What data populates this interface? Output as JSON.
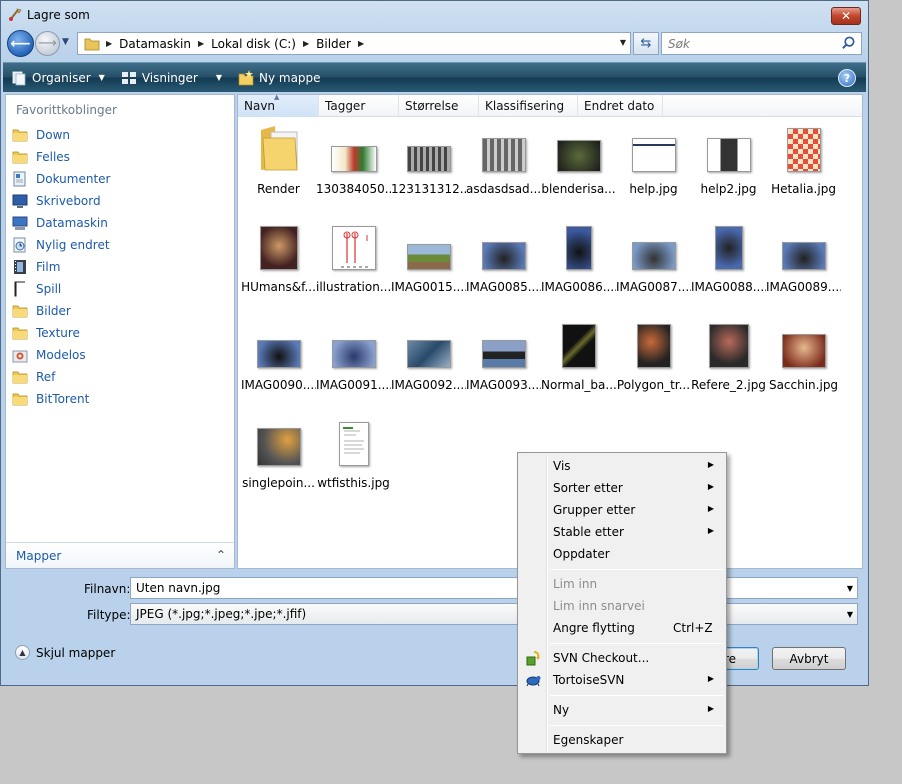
{
  "window": {
    "title": "Lagre som",
    "close_label": "✕"
  },
  "nav": {
    "breadcrumbs": [
      "Datamaskin",
      "Lokal disk (C:)",
      "Bilder"
    ],
    "search_placeholder": "Søk"
  },
  "toolbar": {
    "organize": "Organiser",
    "views": "Visninger",
    "new_folder": "Ny mappe",
    "help": "?"
  },
  "sidebar": {
    "title": "Favorittkoblinger",
    "items": [
      {
        "label": "Down",
        "icon": "folder-icon"
      },
      {
        "label": "Felles",
        "icon": "folder-icon"
      },
      {
        "label": "Dokumenter",
        "icon": "documents-icon"
      },
      {
        "label": "Skrivebord",
        "icon": "desktop-icon"
      },
      {
        "label": "Datamaskin",
        "icon": "computer-icon"
      },
      {
        "label": "Nylig endret",
        "icon": "recent-icon"
      },
      {
        "label": "Film",
        "icon": "film-icon"
      },
      {
        "label": "Spill",
        "icon": "blank-icon"
      },
      {
        "label": "Bilder",
        "icon": "folder-icon"
      },
      {
        "label": "Texture",
        "icon": "folder-icon"
      },
      {
        "label": "Modelos",
        "icon": "modelos-icon"
      },
      {
        "label": "Ref",
        "icon": "folder-icon"
      },
      {
        "label": "BitTorent",
        "icon": "folder-icon"
      }
    ],
    "folders_label": "Mapper"
  },
  "columns": [
    "Navn",
    "Tagger",
    "Størrelse",
    "Klassifisering",
    "Endret dato"
  ],
  "files": [
    {
      "name": "Render",
      "kind": "folder"
    },
    {
      "name": "130384050...",
      "kind": "image"
    },
    {
      "name": "123131312...",
      "kind": "image"
    },
    {
      "name": "asdasdsad...",
      "kind": "image"
    },
    {
      "name": "blenderisa...",
      "kind": "image"
    },
    {
      "name": "help.jpg",
      "kind": "image"
    },
    {
      "name": "help2.jpg",
      "kind": "image"
    },
    {
      "name": "Hetalia.jpg",
      "kind": "image"
    },
    {
      "name": "HUmans&f...",
      "kind": "image"
    },
    {
      "name": "illustration....",
      "kind": "image"
    },
    {
      "name": "IMAG0015....",
      "kind": "image"
    },
    {
      "name": "IMAG0085....",
      "kind": "image"
    },
    {
      "name": "IMAG0086....",
      "kind": "image"
    },
    {
      "name": "IMAG0087....",
      "kind": "image"
    },
    {
      "name": "IMAG0088....",
      "kind": "image"
    },
    {
      "name": "IMAG0089....",
      "kind": "image"
    },
    {
      "name": "IMAG0090....",
      "kind": "image"
    },
    {
      "name": "IMAG0091....",
      "kind": "image"
    },
    {
      "name": "IMAG0092....",
      "kind": "image"
    },
    {
      "name": "IMAG0093....",
      "kind": "image"
    },
    {
      "name": "Normal_ba...",
      "kind": "image"
    },
    {
      "name": "Polygon_tr...",
      "kind": "image"
    },
    {
      "name": "Refere_2.jpg",
      "kind": "image"
    },
    {
      "name": "Sacchin.jpg",
      "kind": "image"
    },
    {
      "name": "singlepoin...",
      "kind": "image"
    },
    {
      "name": "wtfisthis.jpg",
      "kind": "image"
    }
  ],
  "form": {
    "filename_label": "Filnavn:",
    "filename_value": "Uten navn.jpg",
    "filetype_label": "Filtype:",
    "filetype_value": "JPEG (*.jpg;*.jpeg;*.jpe;*.jfif)",
    "hide_folders": "Skjul mapper",
    "save_label_visible": "re",
    "cancel_label": "Avbryt"
  },
  "context_menu": {
    "items": [
      {
        "label": "Vis",
        "submenu": true
      },
      {
        "label": "Sorter etter",
        "submenu": true
      },
      {
        "label": "Grupper etter",
        "submenu": true
      },
      {
        "label": "Stable etter",
        "submenu": true
      },
      {
        "label": "Oppdater"
      },
      {
        "label": "Lim inn",
        "disabled": true
      },
      {
        "label": "Lim inn snarvei",
        "disabled": true
      },
      {
        "label": "Angre flytting",
        "shortcut": "Ctrl+Z"
      },
      {
        "label": "SVN Checkout...",
        "icon": "svn-checkout-icon"
      },
      {
        "label": "TortoiseSVN",
        "submenu": true,
        "icon": "tortoise-icon"
      },
      {
        "label": "Ny",
        "submenu": true
      },
      {
        "label": "Egenskaper"
      }
    ]
  },
  "colors": {
    "link_blue": "#1d5ba8",
    "toolbar_dark": "#1f4a63",
    "close_red": "#c2462c"
  }
}
